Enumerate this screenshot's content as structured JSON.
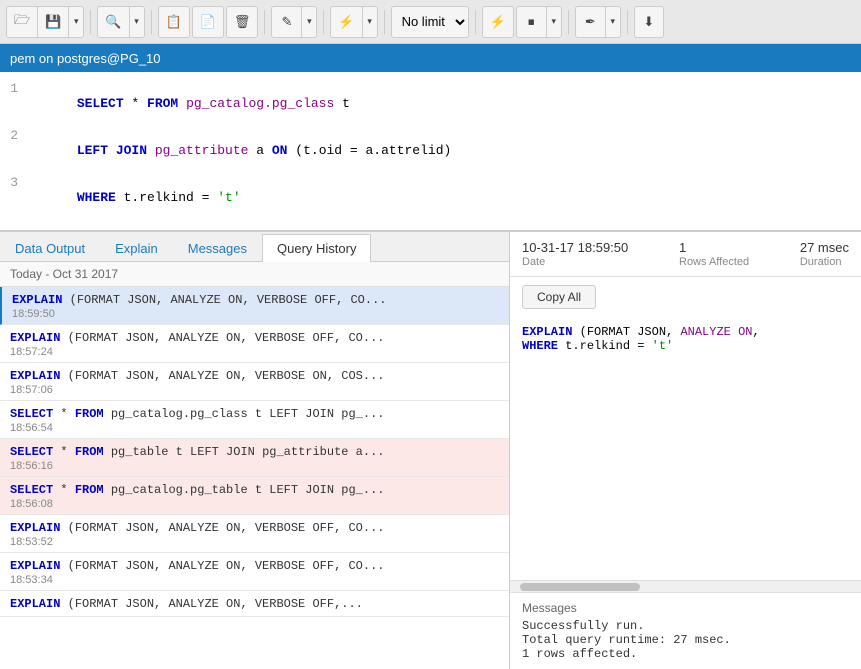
{
  "toolbar": {
    "no_limit_label": "No limit",
    "buttons": [
      {
        "name": "open",
        "icon": "📂",
        "label": "Open"
      },
      {
        "name": "save",
        "icon": "💾",
        "label": "Save"
      },
      {
        "name": "save-dropdown",
        "icon": "▾",
        "label": ""
      },
      {
        "name": "find",
        "icon": "🔍",
        "label": "Find"
      },
      {
        "name": "find-dropdown",
        "icon": "▾",
        "label": ""
      },
      {
        "name": "copy-clipboard",
        "icon": "📋",
        "label": ""
      },
      {
        "name": "paste",
        "icon": "📄",
        "label": ""
      },
      {
        "name": "delete",
        "icon": "🗑",
        "label": ""
      },
      {
        "name": "edit",
        "icon": "✏️",
        "label": ""
      },
      {
        "name": "edit-dropdown",
        "icon": "▾",
        "label": ""
      },
      {
        "name": "filter",
        "icon": "⚡",
        "label": ""
      },
      {
        "name": "filter-dropdown",
        "icon": "▾",
        "label": ""
      },
      {
        "name": "execute-options",
        "icon": "▾",
        "label": ""
      }
    ]
  },
  "title_bar": {
    "text": "pem on postgres@PG_10"
  },
  "sql_lines": [
    {
      "num": "1",
      "code": "SELECT * FROM pg_catalog.pg_class t"
    },
    {
      "num": "2",
      "code": "LEFT JOIN pg_attribute a ON (t.oid = a.attrelid)"
    },
    {
      "num": "3",
      "code": "WHERE t.relkind = 't'"
    }
  ],
  "tabs": [
    {
      "label": "Data Output",
      "active": false
    },
    {
      "label": "Explain",
      "active": false
    },
    {
      "label": "Messages",
      "active": false
    },
    {
      "label": "Query History",
      "active": true
    }
  ],
  "history": {
    "date_label": "Today - Oct 31 2017",
    "items": [
      {
        "query": "EXPLAIN (FORMAT JSON, ANALYZE ON, VERBOSE OFF, CO...",
        "time": "18:59:50",
        "selected": true,
        "error": false
      },
      {
        "query": "EXPLAIN (FORMAT JSON, ANALYZE ON, VERBOSE OFF, CO...",
        "time": "18:57:24",
        "selected": false,
        "error": false
      },
      {
        "query": "EXPLAIN (FORMAT JSON, ANALYZE ON, VERBOSE ON, COS...",
        "time": "18:57:06",
        "selected": false,
        "error": false
      },
      {
        "query": "SELECT * FROM pg_catalog.pg_class t LEFT JOIN pg_...",
        "time": "18:56:54",
        "selected": false,
        "error": false
      },
      {
        "query": "SELECT * FROM pg_table t LEFT JOIN pg_attribute a...",
        "time": "18:56:16",
        "selected": false,
        "error": true
      },
      {
        "query": "SELECT * FROM pg_catalog.pg_table t LEFT JOIN pg_...",
        "time": "18:56:08",
        "selected": false,
        "error": true
      },
      {
        "query": "EXPLAIN (FORMAT JSON, ANALYZE ON, VERBOSE OFF, CO...",
        "time": "18:53:52",
        "selected": false,
        "error": false
      },
      {
        "query": "EXPLAIN (FORMAT JSON, ANALYZE ON, VERBOSE OFF, CO...",
        "time": "18:53:34",
        "selected": false,
        "error": false
      },
      {
        "query": "EXPLAIN (FORMAT JSON, ANALYZE ON, VERBOSE OFF,...",
        "time": "",
        "selected": false,
        "error": false
      }
    ]
  },
  "detail": {
    "date": "10-31-17 18:59:50",
    "date_label": "Date",
    "rows_affected": "1",
    "rows_label": "Rows Affected",
    "duration": "27 msec",
    "duration_label": "Duration",
    "copy_all_label": "Copy All",
    "sql_preview_line1": "EXPLAIN (FORMAT JSON, ANALYZE ON,",
    "sql_preview_line2": "WHERE t.relkind = 't'"
  },
  "messages": {
    "label": "Messages",
    "lines": [
      "Successfully run.",
      "Total query runtime: 27 msec.",
      "1 rows affected."
    ]
  }
}
